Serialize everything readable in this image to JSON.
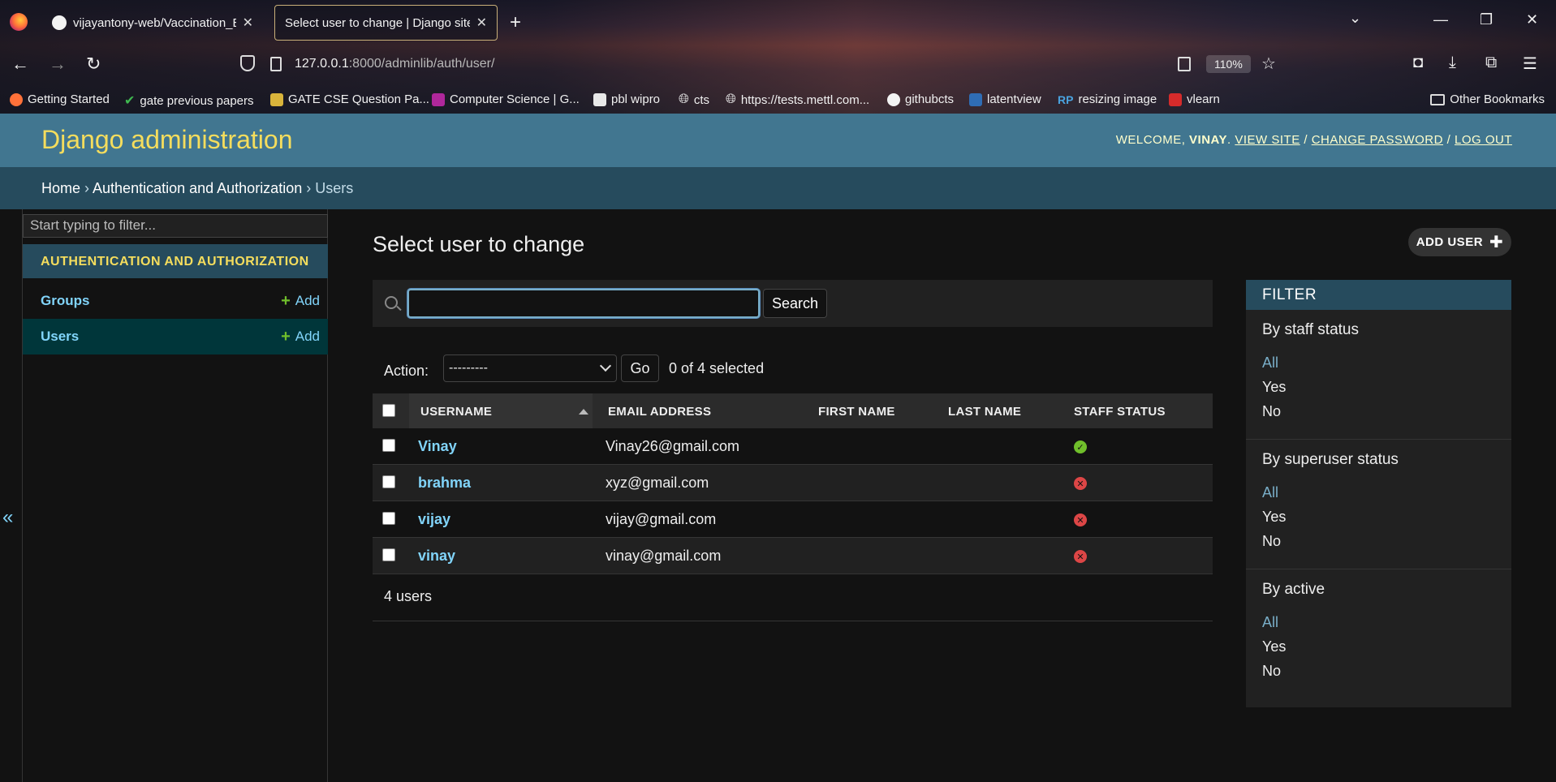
{
  "browser": {
    "tabs": [
      {
        "title": "vijayantony-web/Vaccination_B",
        "active": false
      },
      {
        "title": "Select user to change | Django site",
        "active": true
      }
    ],
    "url_host": "127.0.0.1",
    "url_rest": ":8000/adminlib/auth/user/",
    "zoom": "110%",
    "bookmarks": [
      {
        "label": "Getting Started",
        "icon": "firefox-icon",
        "color": "#ff7139"
      },
      {
        "label": "gate previous papers",
        "icon": "check-icon",
        "color": "#3fb950"
      },
      {
        "label": "GATE CSE Question Pa...",
        "icon": "stack-icon",
        "color": "#d9b43b"
      },
      {
        "label": "Computer Science | G...",
        "icon": "g-icon",
        "color": "#b0279b"
      },
      {
        "label": "pbl wipro",
        "icon": "page-icon",
        "color": "#e8e8e8"
      },
      {
        "label": "cts",
        "icon": "globe-icon",
        "color": "#dddddd"
      },
      {
        "label": "https://tests.mettl.com...",
        "icon": "globe-icon",
        "color": "#dddddd"
      },
      {
        "label": "githubcts",
        "icon": "github-icon",
        "color": "#f3f3f3"
      },
      {
        "label": "latentview",
        "icon": "lv-icon",
        "color": "#2f6db5"
      },
      {
        "label": "resizing image",
        "icon": "rp-icon",
        "color": "#4aa3df"
      },
      {
        "label": "vlearn",
        "icon": "vl-icon",
        "color": "#d62b2b"
      }
    ],
    "other_bookmarks": "Other Bookmarks"
  },
  "header": {
    "branding": "Django administration",
    "welcome": "WELCOME,",
    "username": "VINAY",
    "view_site": "VIEW SITE",
    "change_password": "CHANGE PASSWORD",
    "log_out": "LOG OUT"
  },
  "breadcrumbs": {
    "home": "Home",
    "app": "Authentication and Authorization",
    "current": "Users"
  },
  "sidebar": {
    "filter_placeholder": "Start typing to filter...",
    "app_caption": "AUTHENTICATION AND AUTHORIZATION",
    "models": [
      {
        "name": "Groups",
        "add": "Add",
        "active": false
      },
      {
        "name": "Users",
        "add": "Add",
        "active": true
      }
    ]
  },
  "main": {
    "title": "Select user to change",
    "add_button": "ADD USER",
    "search_value": "",
    "search_button": "Search",
    "action_label": "Action:",
    "action_selected": "---------",
    "go_button": "Go",
    "selected_count": "0 of 4 selected",
    "columns": [
      "USERNAME",
      "EMAIL ADDRESS",
      "FIRST NAME",
      "LAST NAME",
      "STAFF STATUS"
    ],
    "rows": [
      {
        "username": "Vinay",
        "email": "Vinay26@gmail.com",
        "first_name": "",
        "last_name": "",
        "staff": true
      },
      {
        "username": "brahma",
        "email": "xyz@gmail.com",
        "first_name": "",
        "last_name": "",
        "staff": false
      },
      {
        "username": "vijay",
        "email": "vijay@gmail.com",
        "first_name": "",
        "last_name": "",
        "staff": false
      },
      {
        "username": "vinay",
        "email": "vinay@gmail.com",
        "first_name": "",
        "last_name": "",
        "staff": false
      }
    ],
    "result_count": "4 users"
  },
  "filter": {
    "title": "FILTER",
    "groups": [
      {
        "heading": "By staff status",
        "options": [
          "All",
          "Yes",
          "No"
        ],
        "selected": "All"
      },
      {
        "heading": "By superuser status",
        "options": [
          "All",
          "Yes",
          "No"
        ],
        "selected": "All"
      },
      {
        "heading": "By active",
        "options": [
          "All",
          "Yes",
          "No"
        ],
        "selected": "All"
      }
    ]
  },
  "colors": {
    "header": "#417690",
    "breadcrumbs": "#264b5d",
    "branding": "#f5dd5d",
    "link": "#81d4fa",
    "yes": "#70bf2b",
    "no": "#dd4646"
  }
}
